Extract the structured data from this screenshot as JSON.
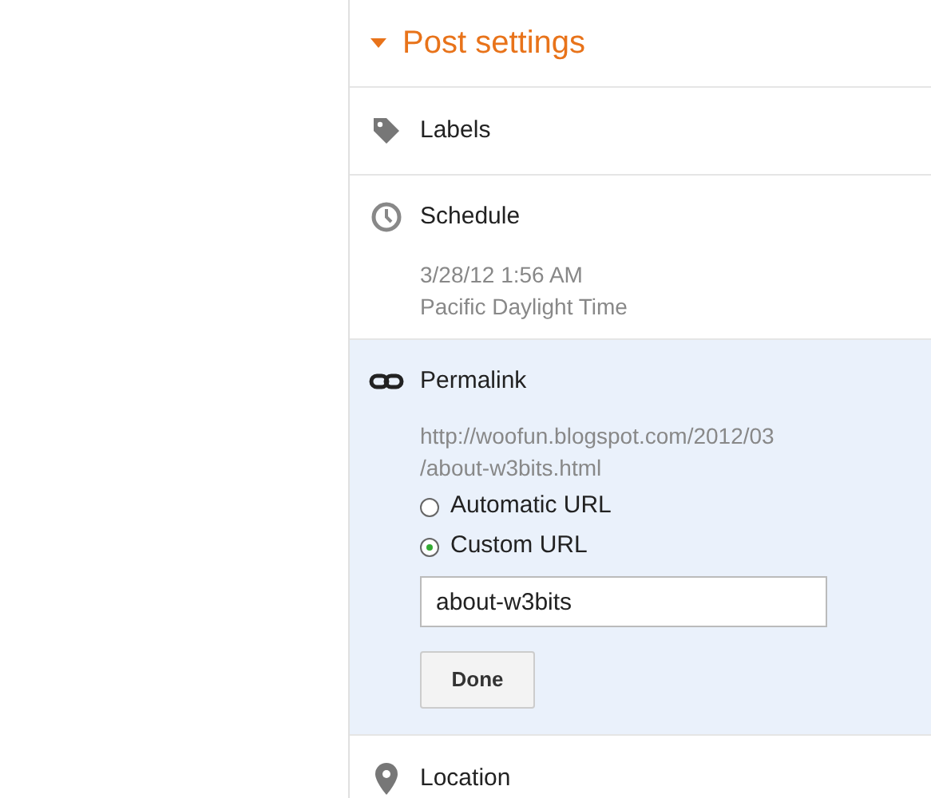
{
  "panel": {
    "title": "Post settings",
    "expanded": true
  },
  "sections": [
    {
      "kind": "labels",
      "label": "Labels",
      "expanded": false
    },
    {
      "kind": "schedule",
      "label": "Schedule",
      "expanded": false,
      "details": [
        "3/28/12 1:56 AM",
        "Pacific Daylight Time"
      ]
    },
    {
      "kind": "permalink",
      "label": "Permalink",
      "expanded": true,
      "url_lines": [
        "http://woofun.blogspot.com/2012/03",
        "/about-w3bits.html"
      ],
      "options": [
        {
          "label": "Automatic URL",
          "selected": false
        },
        {
          "label": "Custom URL",
          "selected": true
        }
      ],
      "field": {
        "value": "about-w3bits"
      },
      "button": "Done"
    },
    {
      "kind": "location",
      "label": "Location",
      "expanded": false
    }
  ]
}
